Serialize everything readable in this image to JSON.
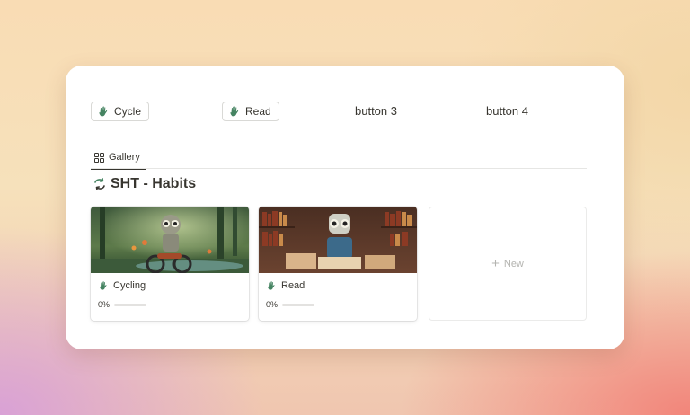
{
  "buttons": [
    {
      "label": "Cycle",
      "icon": "hand-icon"
    },
    {
      "label": "Read",
      "icon": "hand-icon"
    },
    {
      "label": "button 3"
    },
    {
      "label": "button 4"
    }
  ],
  "view_tab": {
    "label": "Gallery",
    "icon": "gallery-grid-icon"
  },
  "database": {
    "title": "SHT - Habits",
    "icon": "sync-arrows-icon"
  },
  "cards": [
    {
      "title": "Cycling",
      "icon": "hand-icon",
      "progress_label": "0%",
      "progress": 0
    },
    {
      "title": "Read",
      "icon": "hand-icon",
      "progress_label": "0%",
      "progress": 0
    }
  ],
  "new_card": {
    "label": "New",
    "icon": "plus-icon"
  },
  "colors": {
    "text": "#37352f",
    "icon_green": "#448361",
    "progress": "#2f80ed"
  }
}
